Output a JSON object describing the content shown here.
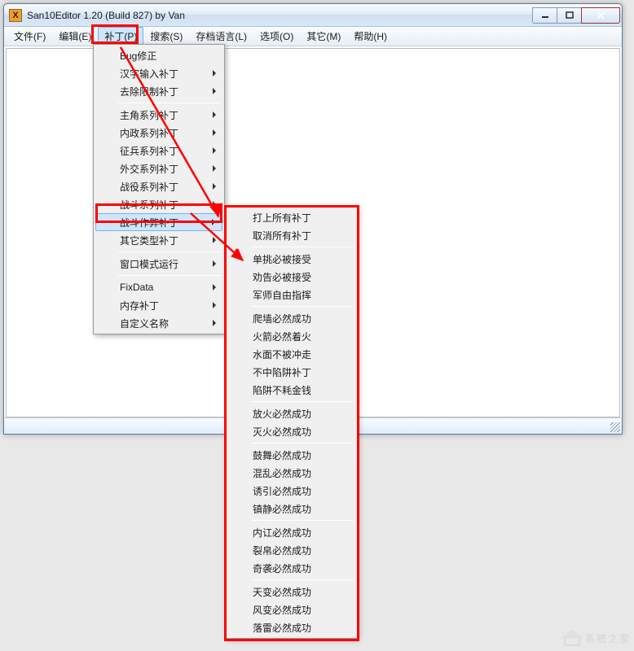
{
  "window": {
    "title": "San10Editor 1.20 (Build 827) by Van",
    "icon_letter": "X"
  },
  "menubar": {
    "items": [
      {
        "label": "文件(F)",
        "active": false
      },
      {
        "label": "编辑(E)",
        "active": false
      },
      {
        "label": "补丁(P)",
        "active": true
      },
      {
        "label": "搜索(S)",
        "active": false
      },
      {
        "label": "存档语言(L)",
        "active": false
      },
      {
        "label": "选项(O)",
        "active": false
      },
      {
        "label": "其它(M)",
        "active": false
      },
      {
        "label": "帮助(H)",
        "active": false
      }
    ]
  },
  "dropdown": {
    "groups": [
      [
        {
          "label": "Bug修正",
          "arrow": false
        },
        {
          "label": "汉字输入补丁",
          "arrow": true
        },
        {
          "label": "去除限制补丁",
          "arrow": true
        }
      ],
      [
        {
          "label": "主角系列补丁",
          "arrow": true
        },
        {
          "label": "内政系列补丁",
          "arrow": true
        },
        {
          "label": "征兵系列补丁",
          "arrow": true
        },
        {
          "label": "外交系列补丁",
          "arrow": true
        },
        {
          "label": "战役系列补丁",
          "arrow": true
        },
        {
          "label": "战斗系列补丁",
          "arrow": true
        },
        {
          "label": "战斗作弊补丁",
          "arrow": true,
          "highlighted": true
        },
        {
          "label": "其它类型补丁",
          "arrow": true
        }
      ],
      [
        {
          "label": "窗口模式运行",
          "arrow": true
        }
      ],
      [
        {
          "label": "FixData",
          "arrow": true
        },
        {
          "label": "内存补丁",
          "arrow": true
        },
        {
          "label": "自定义名称",
          "arrow": true
        }
      ]
    ]
  },
  "submenu": {
    "groups": [
      [
        {
          "label": "打上所有补丁"
        },
        {
          "label": "取消所有补丁"
        }
      ],
      [
        {
          "label": "单挑必被接受"
        },
        {
          "label": "劝告必被接受"
        },
        {
          "label": "军师自由指挥"
        }
      ],
      [
        {
          "label": "爬墙必然成功"
        },
        {
          "label": "火箭必然着火"
        },
        {
          "label": "水面不被冲走"
        },
        {
          "label": "不中陷阱补丁"
        },
        {
          "label": "陷阱不耗金钱"
        }
      ],
      [
        {
          "label": "放火必然成功"
        },
        {
          "label": "灭火必然成功"
        }
      ],
      [
        {
          "label": "鼓舞必然成功"
        },
        {
          "label": "混乱必然成功"
        },
        {
          "label": "诱引必然成功"
        },
        {
          "label": "镇静必然成功"
        }
      ],
      [
        {
          "label": "内讧必然成功"
        },
        {
          "label": "裂帛必然成功"
        },
        {
          "label": "奇袭必然成功"
        }
      ],
      [
        {
          "label": "天变必然成功"
        },
        {
          "label": "风变必然成功"
        },
        {
          "label": "落雷必然成功"
        }
      ]
    ]
  },
  "watermark": {
    "text": "系统之家"
  }
}
